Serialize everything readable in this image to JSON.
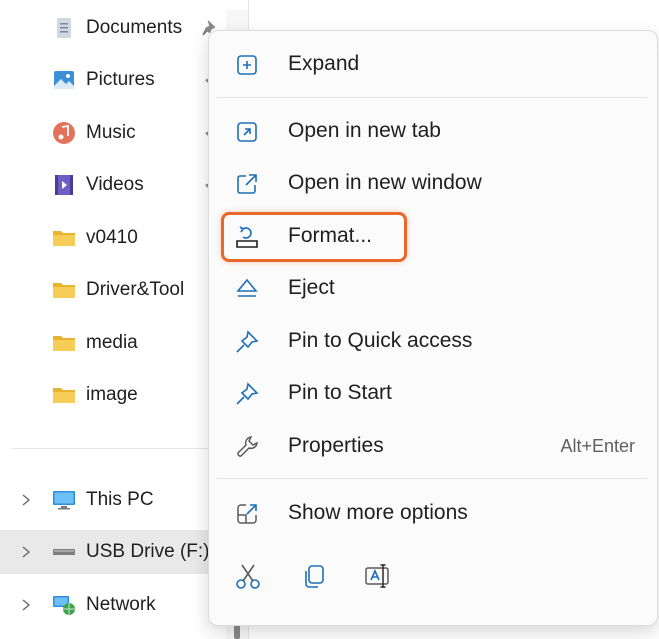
{
  "nav": {
    "quick_access": [
      {
        "label": "Documents",
        "icon": "documents-icon"
      },
      {
        "label": "Pictures",
        "icon": "pictures-icon"
      },
      {
        "label": "Music",
        "icon": "music-icon"
      },
      {
        "label": "Videos",
        "icon": "videos-icon"
      },
      {
        "label": "v0410",
        "icon": "folder-icon"
      },
      {
        "label": "Driver&Tool",
        "icon": "folder-icon"
      },
      {
        "label": "media",
        "icon": "folder-icon"
      },
      {
        "label": "image",
        "icon": "folder-icon"
      }
    ],
    "locations": [
      {
        "label": "This PC",
        "icon": "this-pc-icon"
      },
      {
        "label": "USB Drive (F:)",
        "icon": "usb-drive-icon",
        "selected": true
      },
      {
        "label": "Network",
        "icon": "network-icon"
      }
    ]
  },
  "menu": {
    "expand": "Expand",
    "open_new_tab": "Open in new tab",
    "open_new_window": "Open in new window",
    "format": "Format...",
    "eject": "Eject",
    "pin_quick_access": "Pin to Quick access",
    "pin_start": "Pin to Start",
    "properties": "Properties",
    "properties_shortcut": "Alt+Enter",
    "show_more": "Show more options"
  },
  "colors": {
    "accent": "#1e6fb8",
    "highlight": "#e8682a",
    "folder": "#f4c542"
  }
}
